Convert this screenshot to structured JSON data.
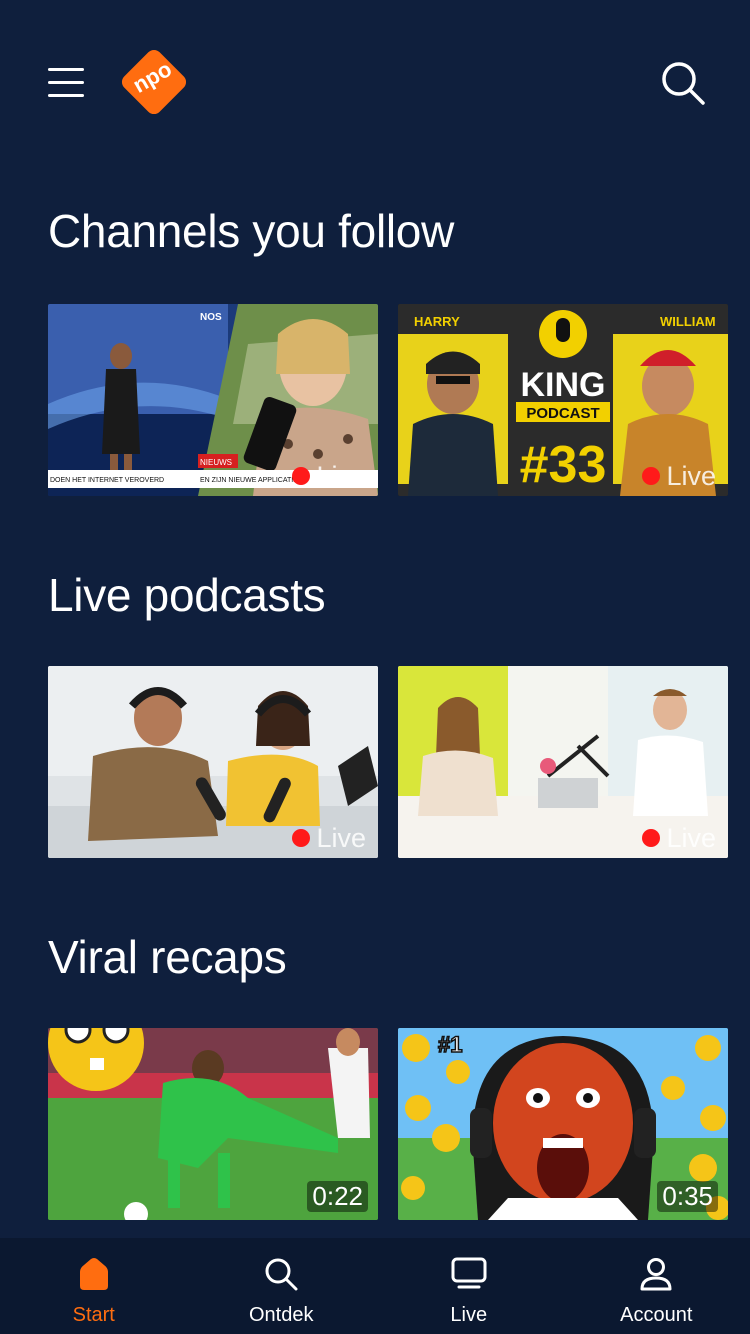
{
  "colors": {
    "background": "#0f1f3d",
    "tabbar": "#0b1830",
    "accent": "#ff6d10",
    "live_dot": "#ff1a1a"
  },
  "header": {
    "logo_text": "npo",
    "menu_icon": "hamburger-menu-icon",
    "search_icon": "search-icon"
  },
  "sections": [
    {
      "title": "Channels you follow",
      "cards": [
        {
          "thumbnail": "news-broadcast-thumbnail",
          "thumb_texts": [
            "NOS",
            "NIEUWS",
            "DOEN HET INTERNET VEROVERD",
            "EN ZIJN NIEUWE APPLICATIE"
          ],
          "badge": "live",
          "live_label": "Live"
        },
        {
          "thumbnail": "king-podcast-thumbnail",
          "thumb_texts": [
            "HARRY",
            "WILLIAM",
            "KING",
            "PODCAST",
            "#33"
          ],
          "badge": "live",
          "live_label": "Live"
        }
      ]
    },
    {
      "title": "Live podcasts",
      "cards": [
        {
          "thumbnail": "podcast-studio-couple-thumbnail",
          "badge": "live",
          "live_label": "Live"
        },
        {
          "thumbnail": "podcast-office-interview-thumbnail",
          "badge": "live",
          "live_label": "Live"
        }
      ]
    },
    {
      "title": "Viral recaps",
      "cards": [
        {
          "thumbnail": "football-jersey-pull-thumbnail",
          "badge": "duration",
          "duration": "0:22"
        },
        {
          "thumbnail": "screaming-gamer-thumbnail",
          "thumb_texts": [
            "#1"
          ],
          "badge": "duration",
          "duration": "0:35"
        }
      ]
    }
  ],
  "tabbar": {
    "tabs": [
      {
        "label": "Start",
        "icon": "home-icon",
        "active": true
      },
      {
        "label": "Ontdek",
        "icon": "search-icon",
        "active": false
      },
      {
        "label": "Live",
        "icon": "tv-icon",
        "active": false
      },
      {
        "label": "Account",
        "icon": "account-icon",
        "active": false
      }
    ]
  }
}
